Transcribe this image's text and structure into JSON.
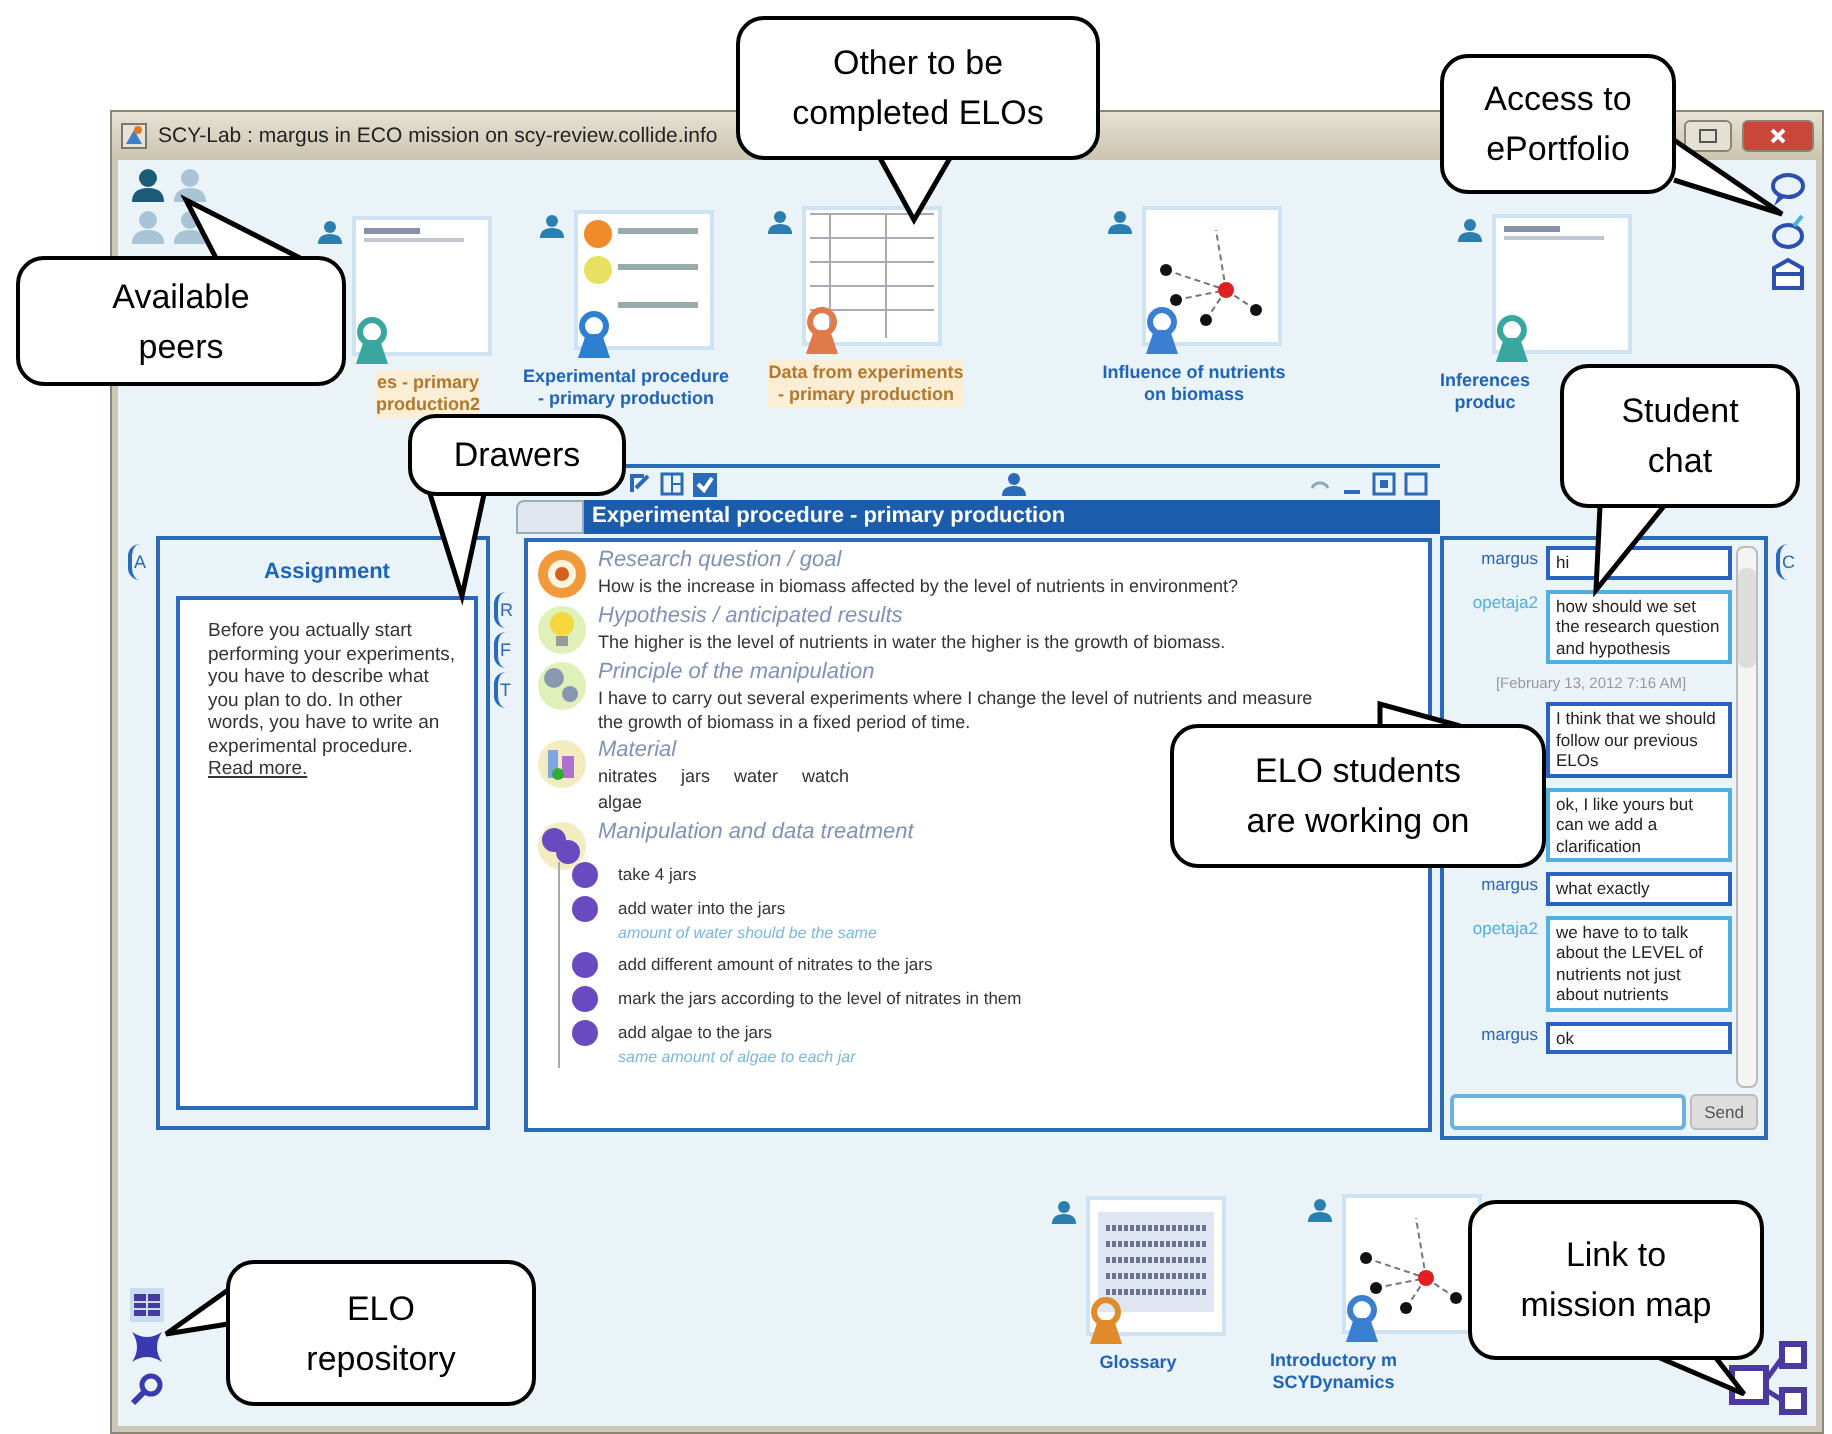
{
  "window": {
    "title": "SCY-Lab : margus in ECO mission on scy-review.collide.info"
  },
  "peers": [
    {
      "online": true
    },
    {
      "online": false
    },
    {
      "online": false
    },
    {
      "online": false
    }
  ],
  "elos": [
    {
      "label": "es - primary\nproduction2",
      "kind": "text",
      "highlighted": true
    },
    {
      "label": "Experimental procedure\n- primary production",
      "kind": "procedure",
      "highlighted": false
    },
    {
      "label": "Data from experiments\n- primary production",
      "kind": "table",
      "highlighted": true
    },
    {
      "label": "Influence of nutrients\non biomass",
      "kind": "map",
      "highlighted": false
    },
    {
      "label": "Inferences\nproduc",
      "kind": "text",
      "highlighted": false
    }
  ],
  "bottom_elos": [
    {
      "label": "Glossary",
      "kind": "glossary",
      "highlighted": false
    },
    {
      "label": "Introductory m\nSCYDynamics",
      "kind": "map",
      "highlighted": false
    }
  ],
  "drawer_tabs": [
    {
      "label": "A"
    },
    {
      "label": "R"
    },
    {
      "label": "F"
    },
    {
      "label": "T"
    },
    {
      "label": "C"
    }
  ],
  "assignment": {
    "title": "Assignment",
    "text": "Before you actually start performing your experiments, you have to describe what you plan to do. In other words, you have to write an experimental procedure.",
    "link": "Read more."
  },
  "elo_window": {
    "title": "Experimental procedure - primary production",
    "sections": [
      {
        "kind": "goal",
        "heading": "Research question / goal",
        "text": "How is the increase in biomass affected by the level of nutrients in environment?"
      },
      {
        "kind": "hypothesis",
        "heading": "Hypothesis / anticipated results",
        "text": "The higher is the level of nutrients in water the higher is the growth of biomass."
      },
      {
        "kind": "principle",
        "heading": "Principle of the manipulation",
        "text": "I have to carry out several experiments where I change the level of nutrients and measure the growth of biomass in a fixed period of time."
      },
      {
        "kind": "material",
        "heading": "Material",
        "items": [
          "nitrates",
          "jars",
          "water",
          "watch",
          "algae"
        ]
      },
      {
        "kind": "steps",
        "heading": "Manipulation and data treatment",
        "steps": [
          {
            "text": "take 4 jars"
          },
          {
            "text": "add water into the jars",
            "note": "amount of water should be the same"
          },
          {
            "text": "add different amount of nitrates to the jars"
          },
          {
            "text": "mark the jars according to the level of nitrates in them"
          },
          {
            "text": "add algae to the jars",
            "note": "same amount of algae to each jar"
          }
        ]
      }
    ]
  },
  "chat": {
    "messages": [
      {
        "kind": "message",
        "author": "margus",
        "color": "#2b63c0",
        "text": "hi"
      },
      {
        "kind": "message",
        "author": "opetaja2",
        "color": "#4fb0e0",
        "text": "how should we set the research question and hypothesis"
      },
      {
        "kind": "timestamp",
        "text": "[February 13, 2012 7:16 AM]"
      },
      {
        "kind": "message",
        "color": "#2b63c0",
        "text": "I think that we should follow our previous ELOs"
      },
      {
        "kind": "message",
        "color": "#4fb0e0",
        "text": "ok, I like yours but can we add a clarification"
      },
      {
        "kind": "message",
        "author": "margus",
        "color": "#2b63c0",
        "text": "what exactly"
      },
      {
        "kind": "message",
        "author": "opetaja2",
        "color": "#4fb0e0",
        "text": "we have to to talk about the LEVEL of nutrients not just about nutrients"
      },
      {
        "kind": "message",
        "author": "margus",
        "color": "#2b63c0",
        "text": "ok"
      }
    ],
    "send": "Send"
  },
  "callouts": [
    {
      "text": "Available\npeers"
    },
    {
      "text": "Other to be\ncompleted ELOs"
    },
    {
      "text": "Access to\nePortfolio"
    },
    {
      "text": "Drawers"
    },
    {
      "text": "Student\nchat"
    },
    {
      "text": "ELO students\nare working on"
    },
    {
      "text": "ELO\nrepository"
    },
    {
      "text": "Link to\nmission map"
    }
  ]
}
